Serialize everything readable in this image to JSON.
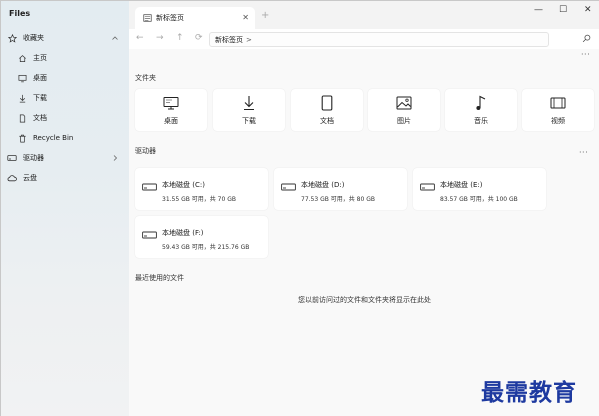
{
  "app": {
    "title": "Files"
  },
  "sidebar": {
    "favorites_label": "收藏夹",
    "favorites": [
      {
        "label": "主页",
        "icon": "home-icon"
      },
      {
        "label": "桌面",
        "icon": "desktop-icon"
      },
      {
        "label": "下载",
        "icon": "download-icon"
      },
      {
        "label": "文档",
        "icon": "document-icon"
      },
      {
        "label": "Recycle Bin",
        "icon": "recycle-bin-icon"
      }
    ],
    "drives_label": "驱动器",
    "cloud_label": "云盘"
  },
  "tabs": [
    {
      "label": "新标签页"
    }
  ],
  "address": {
    "path": "新标签页",
    "separator": ">"
  },
  "folders_section": {
    "title": "文件夹",
    "items": [
      {
        "label": "桌面",
        "icon": "desktop-icon"
      },
      {
        "label": "下载",
        "icon": "download-icon"
      },
      {
        "label": "文档",
        "icon": "document-icon"
      },
      {
        "label": "图片",
        "icon": "picture-icon"
      },
      {
        "label": "音乐",
        "icon": "music-icon"
      },
      {
        "label": "视频",
        "icon": "video-icon"
      }
    ]
  },
  "drives_section": {
    "title": "驱动器",
    "items": [
      {
        "name": "本地磁盘 (C:)",
        "size": "31.55 GB 可用，共 70 GB"
      },
      {
        "name": "本地磁盘 (D:)",
        "size": "77.53 GB 可用，共 80 GB"
      },
      {
        "name": "本地磁盘 (E:)",
        "size": "83.57 GB 可用，共 100 GB"
      },
      {
        "name": "本地磁盘 (F:)",
        "size": "59.43 GB 可用，共 215.76 GB"
      }
    ]
  },
  "recent_section": {
    "title": "最近使用的文件",
    "empty_message": "您以前访问过的文件和文件夹将显示在此处"
  },
  "watermark": "最需教育",
  "window_controls": {
    "minimize": "—",
    "maximize": "☐",
    "close": "✕"
  },
  "nav": {
    "back": "←",
    "forward": "→",
    "up": "↑",
    "refresh": "⟳"
  },
  "new_tab": "+",
  "more": "···",
  "tab_close": "✕"
}
